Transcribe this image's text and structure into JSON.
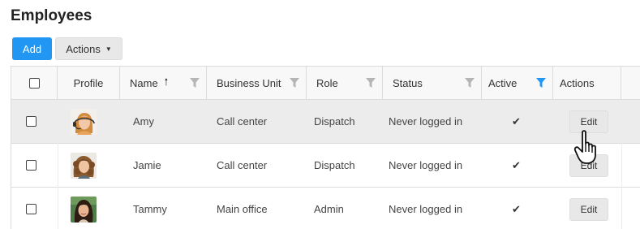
{
  "page": {
    "title": "Employees"
  },
  "toolbar": {
    "add_label": "Add",
    "actions_label": "Actions"
  },
  "columns": {
    "profile": "Profile",
    "name": "Name",
    "business_unit": "Business Unit",
    "role": "Role",
    "status": "Status",
    "active": "Active",
    "actions": "Actions"
  },
  "sort": {
    "column": "Name",
    "direction": "ascending"
  },
  "filter_active_column": "Active",
  "colors": {
    "primary": "#2196f3",
    "filter_inactive": "#b5b5b5",
    "hover_row": "#ececec"
  },
  "rows": [
    {
      "name": "Amy",
      "business_unit": "Call center",
      "role": "Dispatch",
      "status": "Never logged in",
      "active": true,
      "action_label": "Edit",
      "avatar": "woman-with-headset"
    },
    {
      "name": "Jamie",
      "business_unit": "Call center",
      "role": "Dispatch",
      "status": "Never logged in",
      "active": true,
      "action_label": "Edit",
      "avatar": "woman-curly-hair"
    },
    {
      "name": "Tammy",
      "business_unit": "Main office",
      "role": "Admin",
      "status": "Never logged in",
      "active": true,
      "action_label": "Edit",
      "avatar": "woman-dark-hair"
    }
  ],
  "icons": {
    "active_mark": "✔",
    "sort_mark": "🠑",
    "actions_caret": "▼"
  }
}
